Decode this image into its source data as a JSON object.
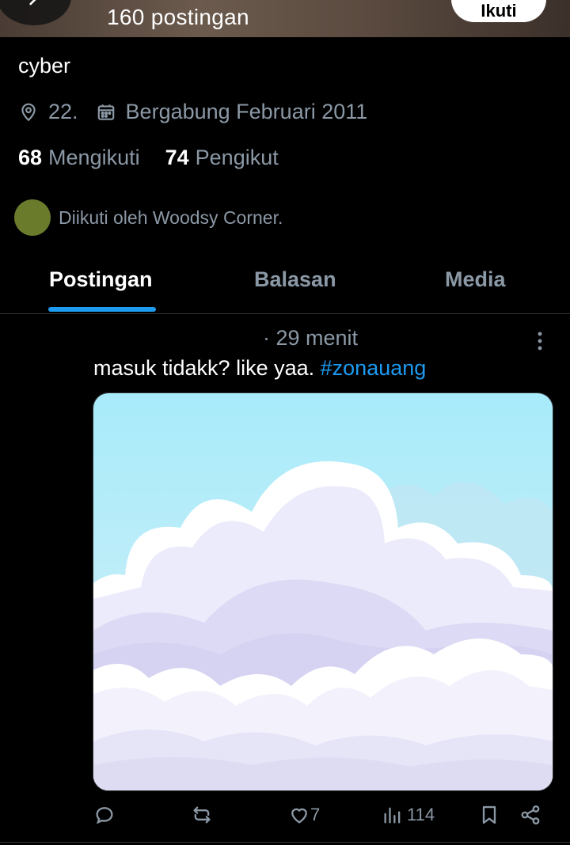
{
  "header": {
    "posts_count_label": "160 postingan",
    "follow_button_label": "Ikuti"
  },
  "profile": {
    "name": "cyber",
    "location": "22.",
    "joined": "Bergabung Februari 2011",
    "following_count": "68",
    "following_label": "Mengikuti",
    "followers_count": "74",
    "followers_label": "Pengikut",
    "followed_by": "Diikuti oleh Woodsy Corner."
  },
  "tabs": [
    {
      "label": "Postingan",
      "active": true
    },
    {
      "label": "Balasan",
      "active": false
    },
    {
      "label": "Media",
      "active": false
    }
  ],
  "post": {
    "time": "· 29 menit",
    "text": "masuk tidakk? like yaa.",
    "hashtag": "#zonauang",
    "likes": "7",
    "views": "114"
  },
  "colors": {
    "accent": "#1d9bf0",
    "background": "#000000",
    "muted_text": "#8b98a5",
    "avatar": "#6b7b2c"
  },
  "icons": {
    "back": "arrow-left-icon",
    "location": "location-pin-icon",
    "calendar": "calendar-icon",
    "more": "more-vertical-icon",
    "reply": "reply-icon",
    "repost": "repost-icon",
    "like": "heart-icon",
    "views": "views-icon",
    "bookmark": "bookmark-icon",
    "share": "share-icon"
  }
}
